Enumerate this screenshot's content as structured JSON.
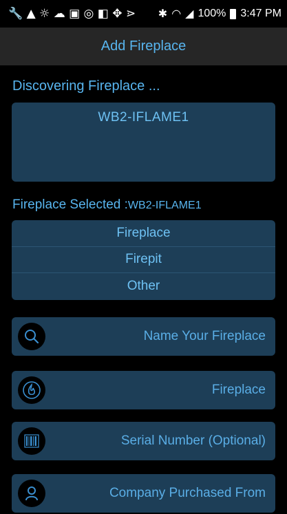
{
  "status_bar": {
    "left_icons": "🔧 ▲ ☼ ☁ ▣ ◎ ◧ ✥ ⋗",
    "bluetooth": "✱",
    "wifi": "◠",
    "signal": "◢",
    "battery_percent": "100%",
    "time": "3:47 PM"
  },
  "header": {
    "title": "Add Fireplace"
  },
  "discovery": {
    "label": "Discovering Fireplace ...",
    "devices": [
      "WB2-IFLAME1"
    ]
  },
  "selection": {
    "label": "Fireplace Selected :",
    "value": "WB2-IFLAME1"
  },
  "types": [
    "Fireplace",
    "Firepit",
    "Other"
  ],
  "fields": {
    "name": {
      "placeholder": "Name Your Fireplace",
      "icon": "search-icon"
    },
    "type": {
      "value": "Fireplace",
      "icon": "flame-icon"
    },
    "serial": {
      "placeholder": "Serial Number (Optional)",
      "icon": "barcode-icon"
    },
    "company": {
      "placeholder": "Company Purchased From",
      "icon": "person-icon"
    }
  },
  "colors": {
    "accent": "#58b5ef",
    "panel": "#1d3e57",
    "header_bg": "#262626",
    "background": "#000000"
  }
}
